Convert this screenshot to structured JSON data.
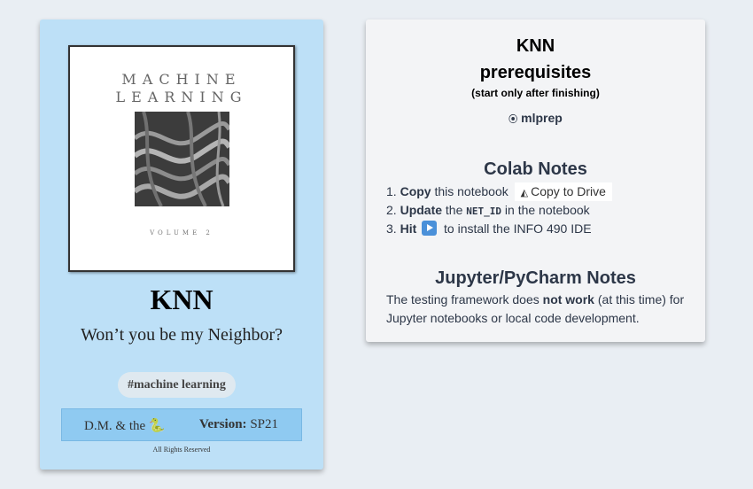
{
  "book": {
    "cover": {
      "title_line1": "MACHINE",
      "title_line2": "LEARNING",
      "volume": "VOLUME 2"
    },
    "title": "KNN",
    "subtitle": "Won’t you be my Neighbor?",
    "tag": "#machine learning",
    "author": "D.M. & the 🐍",
    "version_label": "Version:",
    "version_value": "SP21",
    "rights": "All Rights Reserved"
  },
  "notes": {
    "title": "KNN",
    "prereq_title": "prerequisites",
    "prereq_sub": "(start only after finishing)",
    "prereq_item": "mlprep",
    "colab_title": "Colab Notes",
    "steps": [
      {
        "num": "1.",
        "bold": "Copy",
        "text": "this notebook",
        "button": "Copy to Drive"
      },
      {
        "num": "2.",
        "bold": "Update",
        "text_before": "the",
        "code": "NET_ID",
        "text_after": "in the notebook"
      },
      {
        "num": "3.",
        "bold": "Hit",
        "text": "to install the INFO 490 IDE"
      }
    ],
    "jupyter_title": "Jupyter/PyCharm Notes",
    "jupyter_text_before": "The testing framework does",
    "jupyter_text_bold": "not work",
    "jupyter_text_after": "(at this time) for Jupyter notebooks or local code development."
  }
}
